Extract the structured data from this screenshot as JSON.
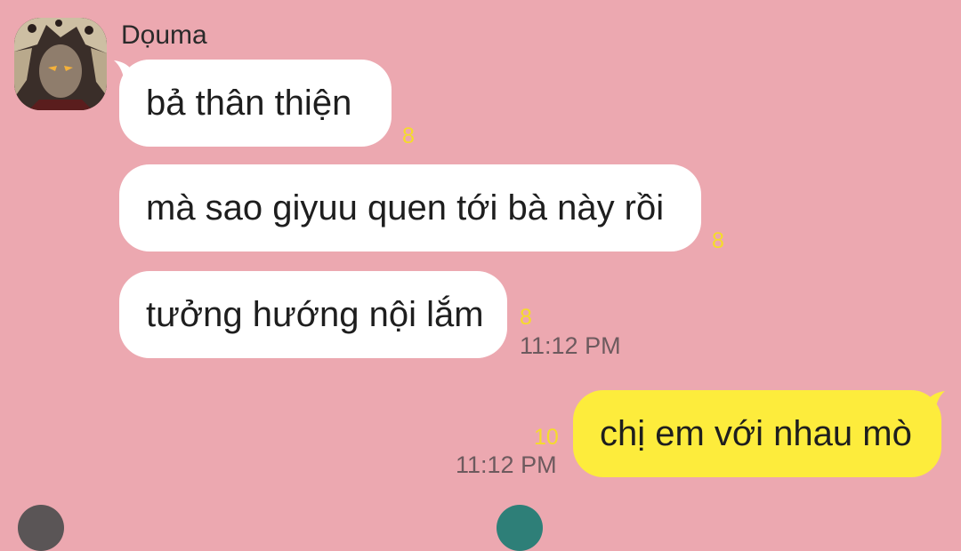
{
  "sender": {
    "name": "Dọuma"
  },
  "messages": [
    {
      "direction": "incoming",
      "text": "bả thân thiện",
      "unread": "8"
    },
    {
      "direction": "incoming",
      "text": "mà sao giyuu quen tới bà này rồi",
      "unread": "8"
    },
    {
      "direction": "incoming",
      "text": "tưởng hướng nội lắm",
      "unread": "8",
      "time": "11:12 PM"
    },
    {
      "direction": "outgoing",
      "text": "chị em với nhau mò",
      "unread": "10",
      "time": "11:12 PM"
    }
  ],
  "colors": {
    "background": "#eca8b0",
    "incoming_bubble": "#ffffff",
    "outgoing_bubble": "#fdec3c",
    "unread_count": "#f5dc2a",
    "timestamp": "#6d5a5e"
  }
}
